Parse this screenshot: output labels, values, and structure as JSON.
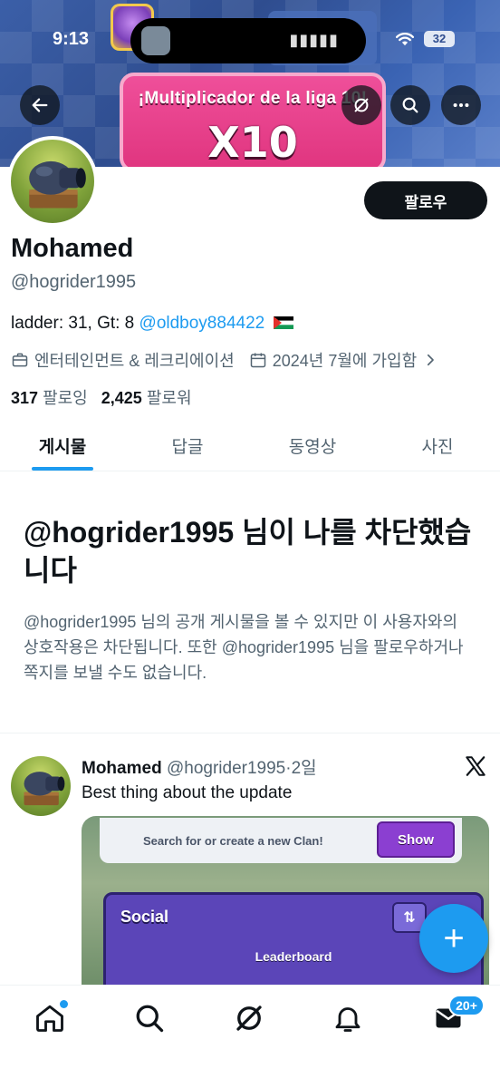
{
  "status_bar": {
    "time": "9:13",
    "battery": "32"
  },
  "banner": {
    "title": "¡Multiplicador de la liga 10!",
    "multiplier": "X10"
  },
  "profile": {
    "display_name": "Mohamed",
    "handle": "@hogrider1995",
    "bio_text": "ladder: 31, Gt: 8 ",
    "bio_mention": "@oldboy884422",
    "category": "엔터테인먼트 & 레크리에이션",
    "joined": "2024년 7월에 가입함",
    "following_count": "317",
    "following_label": "팔로잉",
    "followers_count": "2,425",
    "followers_label": "팔로워",
    "follow_button": "팔로우"
  },
  "tabs": [
    "게시물",
    "답글",
    "동영상",
    "사진"
  ],
  "blocked": {
    "title": "@hogrider1995 님이 나를 차단했습니다",
    "description": "@hogrider1995 님의 공개 게시물을 볼 수 있지만 이 사용자와의 상호작용은 차단됩니다. 또한 @hogrider1995 님을 팔로우하거나 쪽지를 보낼 수도 없습니다."
  },
  "post": {
    "name": "Mohamed",
    "handle": "@hogrider1995",
    "sep": "·",
    "time": "2일",
    "text": "Best thing about the update",
    "media": {
      "search_text": "Search for or create a new Clan!",
      "show_button": "Show",
      "social_title": "Social",
      "leaderboard": "Leaderboard",
      "arrows": "⇅"
    }
  },
  "fab": {
    "label": "+"
  },
  "bottom_nav": {
    "messages_badge": "20+"
  },
  "colors": {
    "accent": "#1d9bf0",
    "text": "#0f1419",
    "muted": "#536471"
  }
}
